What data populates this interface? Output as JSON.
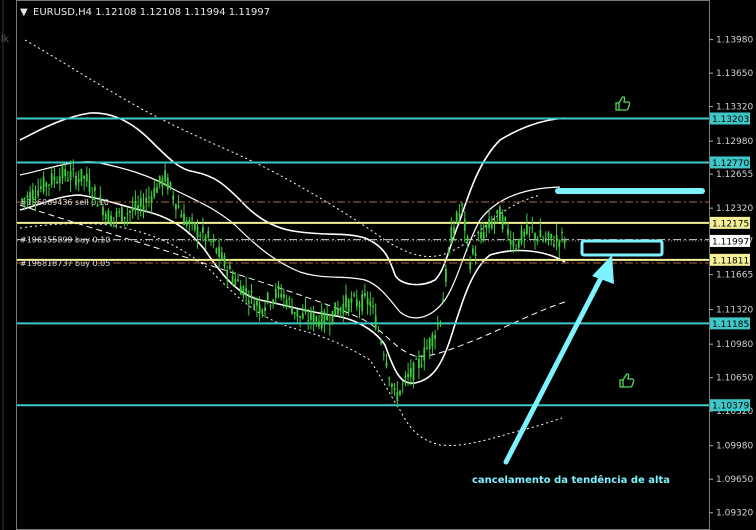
{
  "window": {
    "symbol_info": "EURUSD,H4  1.12108 1.12108 1.11994 1.11997",
    "menu_glyph": "▼",
    "left_edge_fragment": "ilk"
  },
  "colors": {
    "background": "#000000",
    "candle": "#3ecb3e",
    "horizontal_cyan": "#40c8c8",
    "horizontal_yellow": "#f5f096",
    "bands": "#ffffff",
    "order_dash": "#b06a3a",
    "annotation": "#7ff2ff",
    "thumb_icon": "#55d855",
    "tag_cyan_bg": "#3fc6c6",
    "tag_yellow_bg": "#f5f096",
    "tag_white_bg": "#ffffff"
  },
  "orders": [
    {
      "text": "#196069436 sell 0.10",
      "price": 1.1238
    },
    {
      "text": "#196355899 buy 0.10",
      "price": 1.1201
    },
    {
      "text": "#196818737 buy 0.05",
      "price": 1.1178
    }
  ],
  "horizontal_levels": [
    {
      "price": 1.13203,
      "label": "1.13203",
      "color": "cyan"
    },
    {
      "price": 1.1277,
      "label": "1.12770",
      "color": "cyan"
    },
    {
      "price": 1.12175,
      "label": "1.12175",
      "color": "yellow"
    },
    {
      "price": 1.11811,
      "label": "1.11811",
      "color": "yellow"
    },
    {
      "price": 1.11185,
      "label": "1.11185",
      "color": "cyan"
    },
    {
      "price": 1.10379,
      "label": "1.10379",
      "color": "cyan"
    }
  ],
  "current_price": {
    "price": 1.11997,
    "label": "1.11997"
  },
  "price_axis": {
    "min": 1.0915,
    "max": 1.1437,
    "ticks": [
      "1.13980",
      "1.13650",
      "1.13320",
      "1.12980",
      "1.12655",
      "1.12320",
      "1.11997",
      "1.11665",
      "1.11320",
      "1.10980",
      "1.10650",
      "1.10320",
      "1.09980",
      "1.09650",
      "1.09320"
    ]
  },
  "annotation": {
    "text": "cancelamento da tendência de alta"
  },
  "icons": {
    "thumbs_up": "thumbs-up-icon",
    "arrow": "arrow-icon"
  }
}
